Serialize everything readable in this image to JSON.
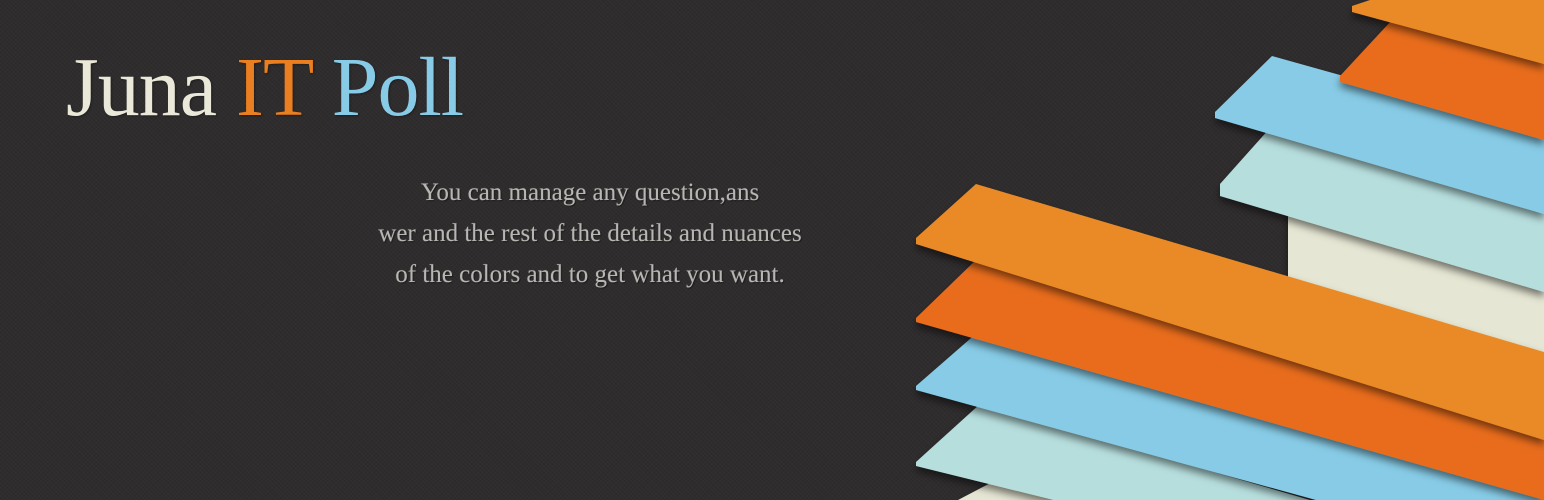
{
  "title": {
    "word_1": "Juna",
    "word_2": "IT",
    "word_3": "Poll"
  },
  "description": {
    "line_1": "You can manage any question,ans",
    "line_2": "wer and the rest of the details and nuances",
    "line_3": "of the colors and to get what you want."
  },
  "colors": {
    "background": "#2f2c2d",
    "title_cream": "#eae9d9",
    "title_orange": "#ea7f22",
    "title_blue": "#87cbe6",
    "stripe_orange": "#ea8a26",
    "stripe_dark_orange": "#e86c1b",
    "stripe_blue": "#87cbe6",
    "stripe_pale_teal": "#b6dedd",
    "stripe_cream": "#e5e6d3"
  }
}
